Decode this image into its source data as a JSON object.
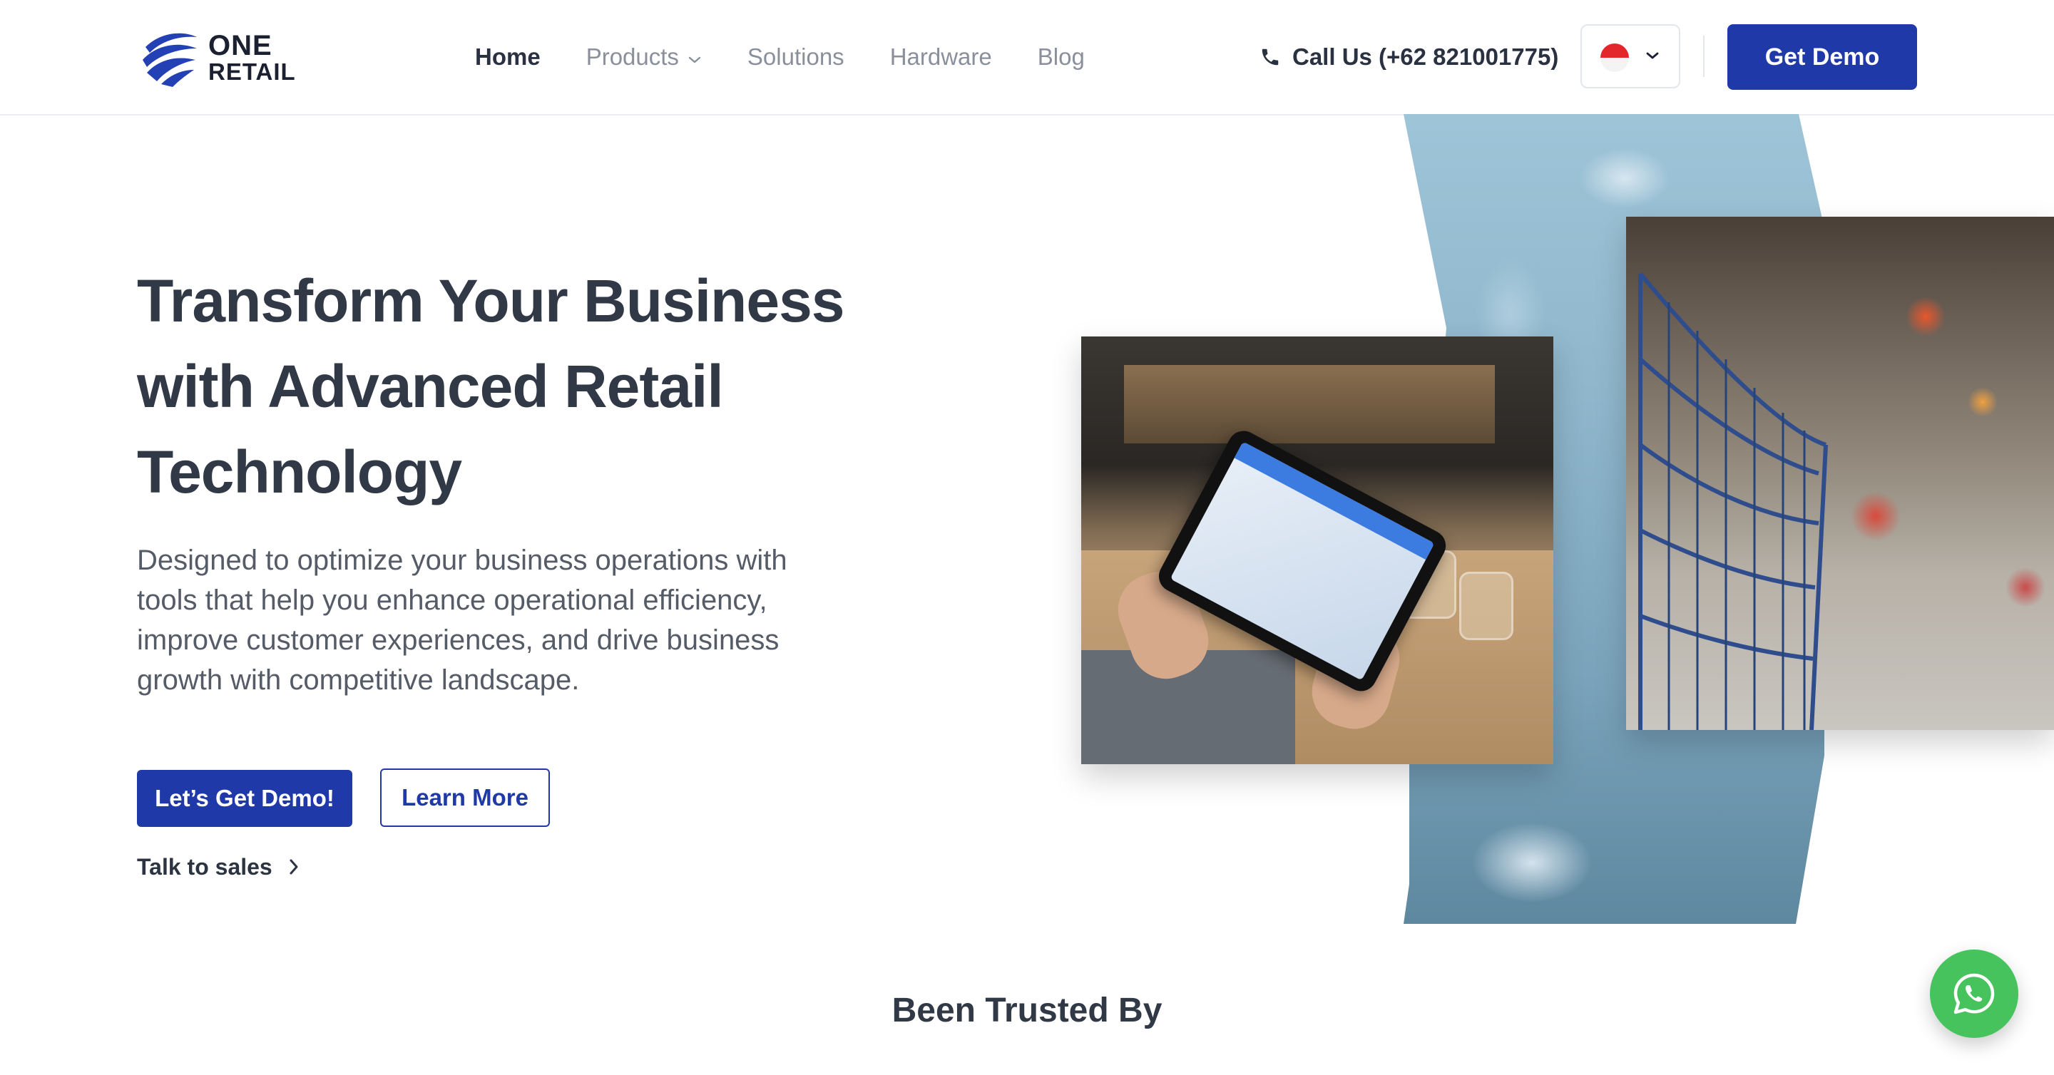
{
  "brand": {
    "line1": "ONE",
    "line2": "RETAIL"
  },
  "nav": {
    "items": [
      {
        "label": "Home",
        "active": true
      },
      {
        "label": "Products",
        "has_dropdown": true
      },
      {
        "label": "Solutions"
      },
      {
        "label": "Hardware"
      },
      {
        "label": "Blog"
      }
    ]
  },
  "header": {
    "call_label": "Call Us (+62 821001775)",
    "language_flag": "indonesia-flag-icon",
    "demo_button": "Get Demo"
  },
  "hero": {
    "title": "Transform Your Business with Advanced Retail Technology",
    "description": "Designed to optimize your business operations with tools that help you enhance operational efficiency, improve customer experiences, and drive business growth with competitive landscape.",
    "primary_button": "Let’s Get Demo!",
    "secondary_button": "Learn More",
    "talk_link": "Talk to sales"
  },
  "trusted": {
    "heading": "Been Trusted By"
  },
  "floating": {
    "icon": "whatsapp-icon"
  },
  "colors": {
    "accent": "#1f3aa8",
    "whatsapp": "#46c35d",
    "text": "#313846"
  }
}
